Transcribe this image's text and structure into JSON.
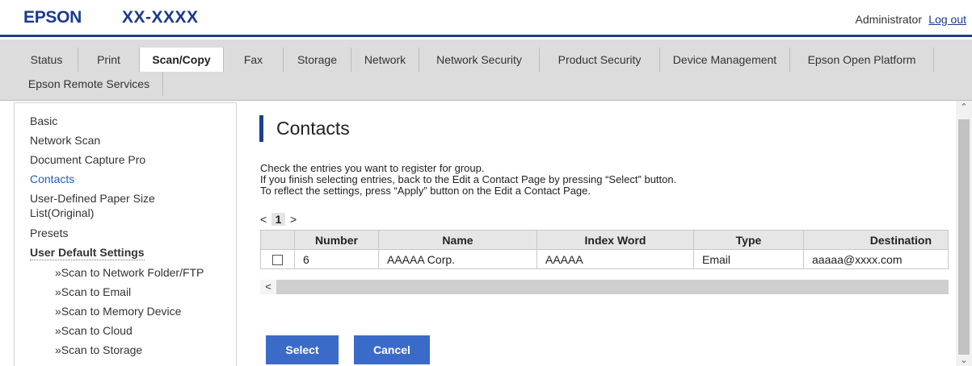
{
  "header": {
    "brand": "EPSON",
    "model": "XX-XXXX",
    "user": "Administrator",
    "logout": "Log out"
  },
  "tabs": [
    {
      "label": "Status",
      "active": false
    },
    {
      "label": "Print",
      "active": false
    },
    {
      "label": "Scan/Copy",
      "active": true
    },
    {
      "label": "Fax",
      "active": false
    },
    {
      "label": "Storage",
      "active": false
    },
    {
      "label": "Network",
      "active": false
    },
    {
      "label": "Network Security",
      "active": false
    },
    {
      "label": "Product Security",
      "active": false
    },
    {
      "label": "Device Management",
      "active": false
    },
    {
      "label": "Epson Open Platform",
      "active": false
    },
    {
      "label": "Epson Remote Services",
      "active": false
    }
  ],
  "sidebar": {
    "items": [
      {
        "label": "Basic"
      },
      {
        "label": "Network Scan"
      },
      {
        "label": "Document Capture Pro"
      },
      {
        "label": "Contacts",
        "active": true
      },
      {
        "label": "User-Defined Paper Size"
      },
      {
        "label": "List(Original)"
      },
      {
        "label": "Presets"
      },
      {
        "label": "User Default Settings"
      },
      {
        "label": "»Scan to Network Folder/FTP"
      },
      {
        "label": "»Scan to Email"
      },
      {
        "label": "»Scan to Memory Device"
      },
      {
        "label": "»Scan to Cloud"
      },
      {
        "label": "»Scan to Storage"
      }
    ]
  },
  "main": {
    "title": "Contacts",
    "instructions": [
      "Check the entries you want to register for group.",
      "If you finish selecting entries, back to the Edit a Contact Page by pressing “Select” button.",
      "To reflect the settings, press “Apply” button on the Edit a Contact Page."
    ],
    "pager": {
      "prev": "<",
      "current": "1",
      "next": ">"
    },
    "table": {
      "columns": [
        "",
        "Number",
        "Name",
        "Index Word",
        "Type",
        "Destination"
      ],
      "rows": [
        {
          "checked": false,
          "number": "6",
          "name": "AAAAA Corp.",
          "index_word": "AAAAA",
          "type": "Email",
          "destination": "aaaaa@xxxx.com"
        }
      ]
    },
    "scroll_left": "<",
    "buttons": {
      "select": "Select",
      "cancel": "Cancel"
    }
  },
  "icons": {
    "scroll_up": "chevron-up-icon",
    "scroll_down": "chevron-down-icon"
  },
  "colors": {
    "brand": "#1d3f8f",
    "link": "#1f5fbf",
    "button": "#3b6bc8",
    "tab_bar": "#dcdcdc"
  }
}
